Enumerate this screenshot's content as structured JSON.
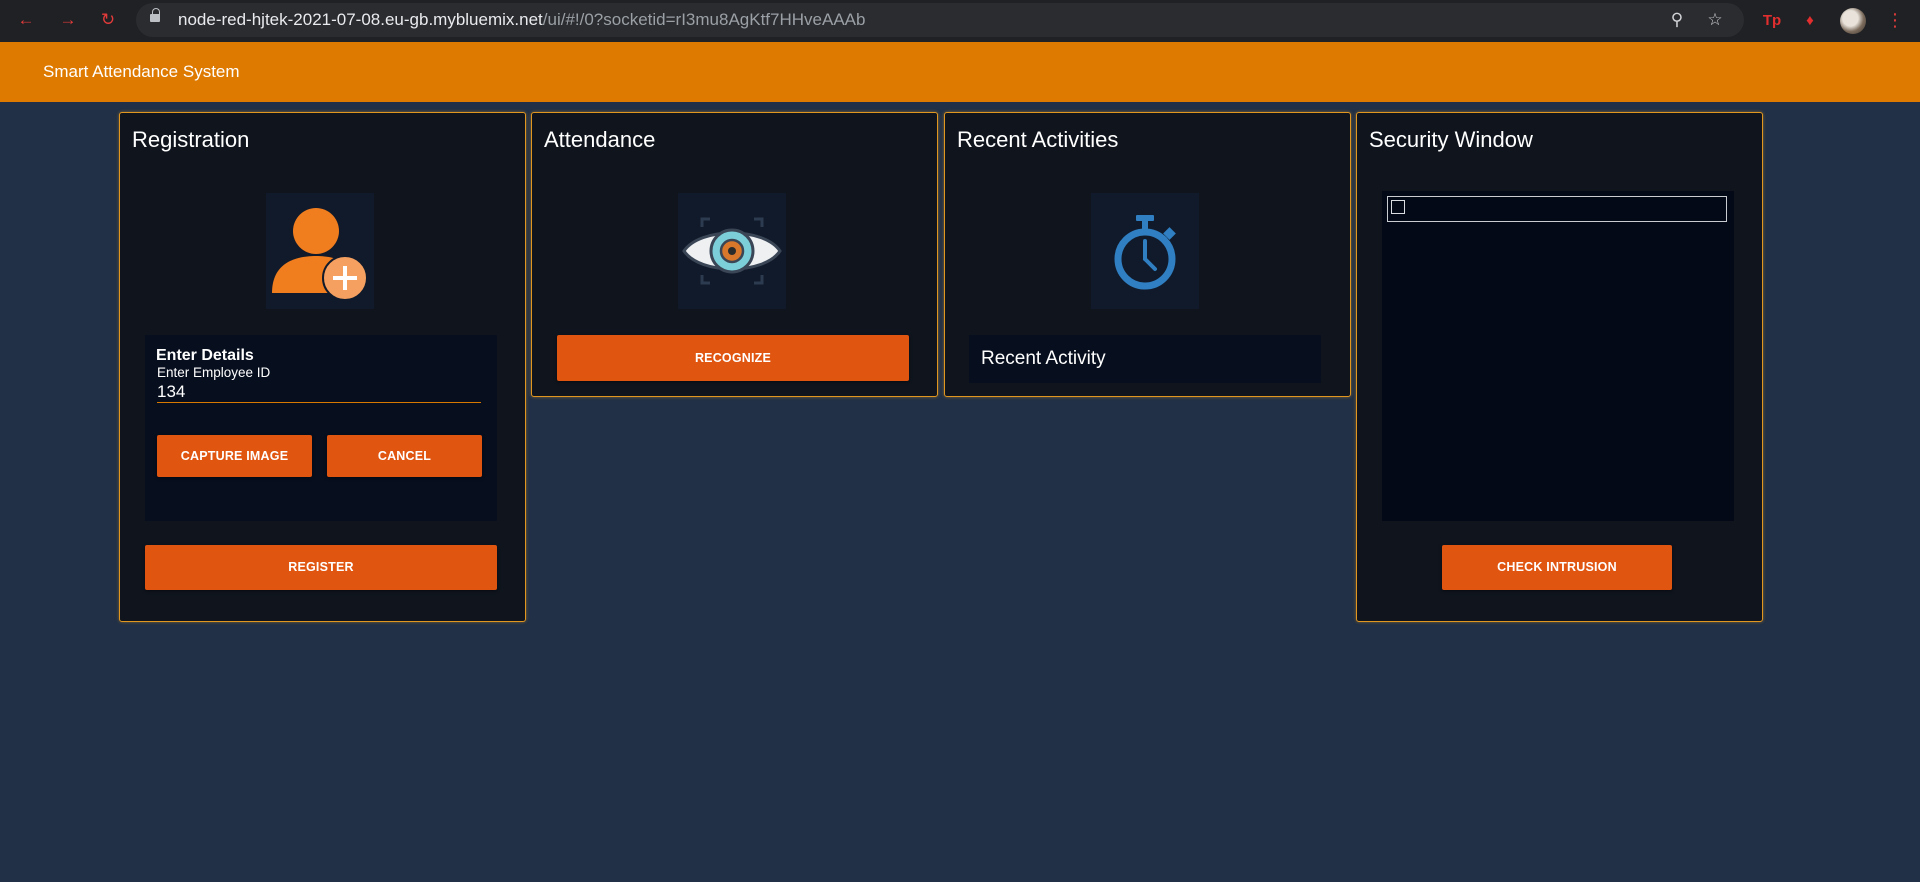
{
  "browser": {
    "url_host": "node-red-hjtek-2021-07-08.eu-gb.mybluemix.net",
    "url_path": "/ui/#!/0?socketid=rI3mu8AgKtf7HHveAAAb",
    "extension_label": "Tp"
  },
  "app": {
    "title": "Smart Attendance System"
  },
  "registration": {
    "title": "Registration",
    "icon": "add-user-icon",
    "details_title": "Enter Details",
    "employee_id_label": "Enter Employee ID",
    "employee_id_value": "134",
    "capture_label": "CAPTURE IMAGE",
    "cancel_label": "CANCEL",
    "register_label": "REGISTER"
  },
  "attendance": {
    "title": "Attendance",
    "icon": "eye-scan-icon",
    "recognize_label": "RECOGNIZE"
  },
  "recent": {
    "title": "Recent Activities",
    "icon": "stopwatch-icon",
    "activity_text": "Recent Activity"
  },
  "security": {
    "title": "Security Window",
    "check_label": "CHECK INTRUSION"
  },
  "colors": {
    "header": "#de7a00",
    "button": "#e05510",
    "card_border": "#e0961f",
    "background": "#213046",
    "card": "#0f141d"
  }
}
